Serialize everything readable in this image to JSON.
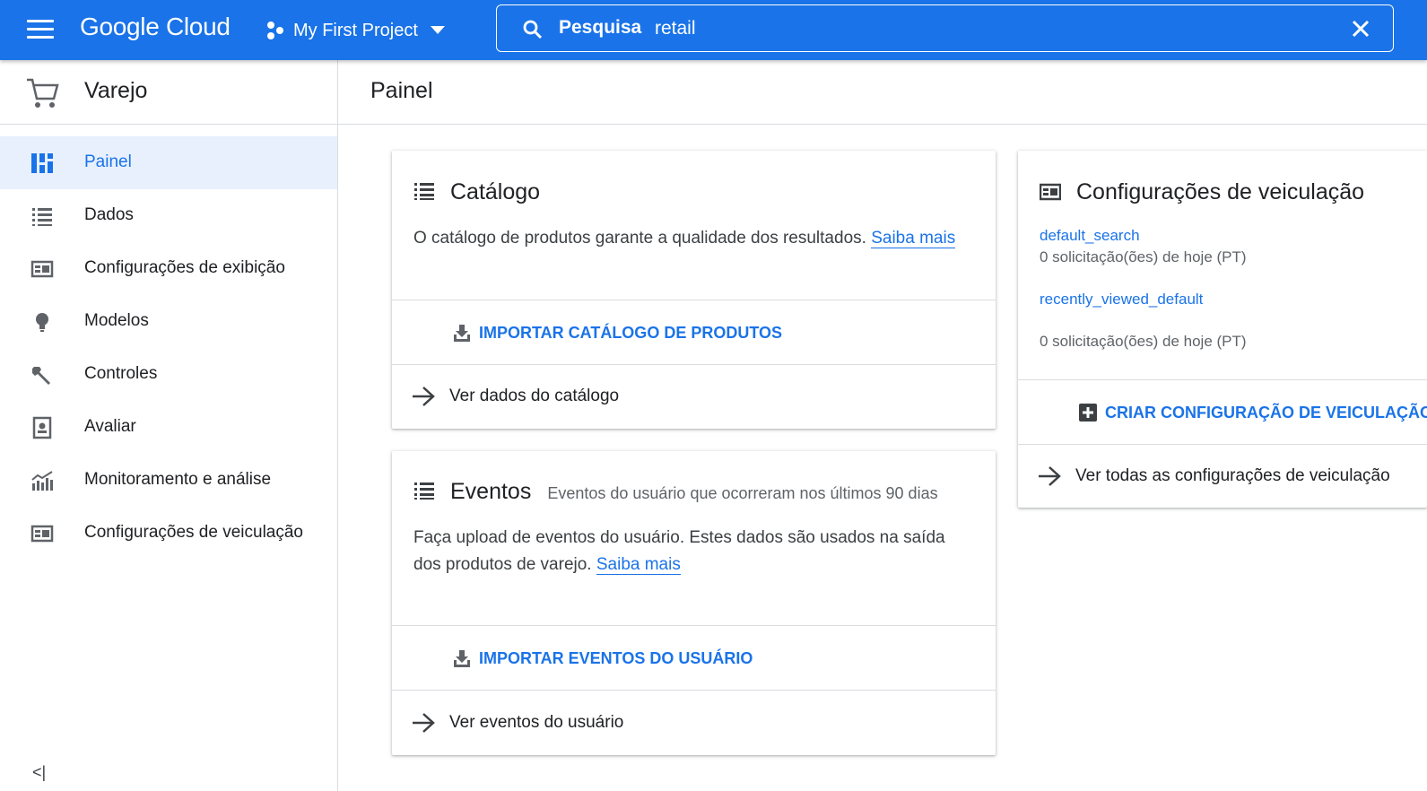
{
  "topbar": {
    "logo": "Google Cloud",
    "project": "My First Project",
    "search_label": "Pesquisa",
    "search_value": "retail"
  },
  "sidebar": {
    "title": "Varejo",
    "items": [
      {
        "label": "Painel",
        "icon": "dashboard-icon"
      },
      {
        "label": "Dados",
        "icon": "list-icon"
      },
      {
        "label": "Configurações de exibição",
        "icon": "table-config-icon"
      },
      {
        "label": "Modelos",
        "icon": "lightbulb-icon"
      },
      {
        "label": "Controles",
        "icon": "wrench-icon"
      },
      {
        "label": "Avaliar",
        "icon": "evaluate-icon"
      },
      {
        "label": "Monitoramento e análise",
        "icon": "analytics-icon"
      },
      {
        "label": "Configurações de veiculação",
        "icon": "serving-config-icon"
      }
    ],
    "collapse": "<|"
  },
  "main": {
    "title": "Painel",
    "catalog": {
      "title": "Catálogo",
      "body": "O catálogo de produtos garante a qualidade dos resultados.",
      "learn_more": "Saiba mais",
      "import_action": "IMPORTAR CATÁLOGO DE PRODUTOS",
      "view_link": "Ver dados do catálogo"
    },
    "events": {
      "title": "Eventos",
      "subtitle": "Eventos do usuário que ocorreram nos últimos 90 dias",
      "body": "Faça upload de eventos do usuário. Estes dados são usados na saída dos produtos de varejo.",
      "learn_more": "Saiba mais",
      "import_action": "IMPORTAR EVENTOS DO USUÁRIO",
      "view_link": "Ver eventos do usuário"
    },
    "serving": {
      "title": "Configurações de veiculação",
      "configs": [
        {
          "name": "default_search",
          "count": "0 solicitação(ões) de hoje (PT)"
        },
        {
          "name": "recently_viewed_default",
          "count": "0 solicitação(ões) de hoje (PT)"
        }
      ],
      "create_action": "CRIAR CONFIGURAÇÃO DE VEICULAÇÃO",
      "view_link": "Ver todas as configurações de veiculação"
    }
  },
  "colors": {
    "brand_blue": "#1a73e8",
    "active_bg": "#e8f0fe",
    "divider": "#dadce0"
  }
}
